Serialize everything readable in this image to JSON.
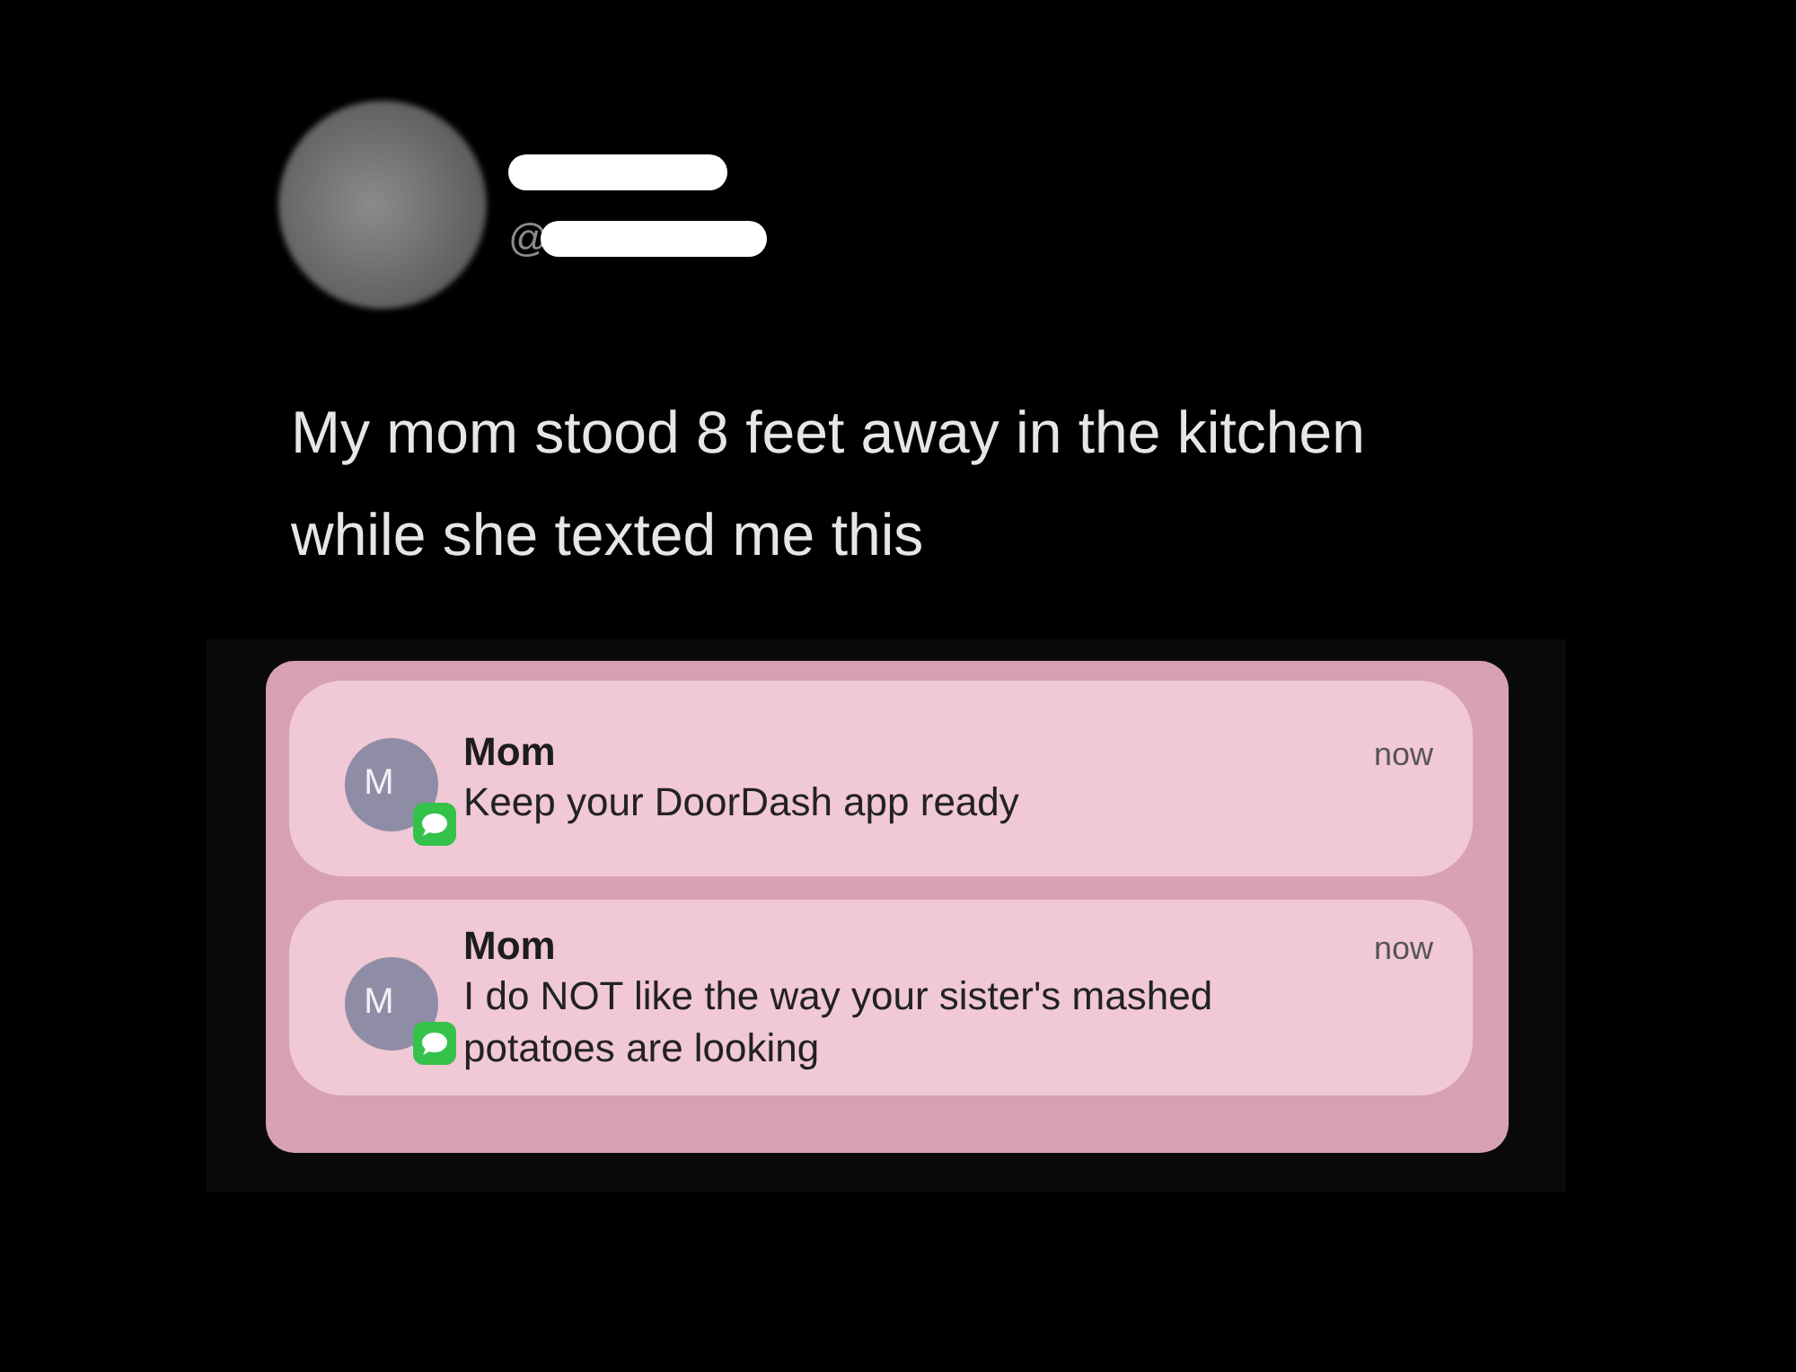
{
  "tweet": {
    "handle_prefix": "@",
    "text": "My mom stood 8 feet away in the kitchen while she texted me this"
  },
  "screenshot": {
    "notifications": [
      {
        "avatar_letter": "M",
        "sender": "Mom",
        "message": "Keep your DoorDash app ready",
        "time": "now"
      },
      {
        "avatar_letter": "M",
        "sender": "Mom",
        "message": "I do NOT like the way your sister's mashed potatoes are looking",
        "time": "now"
      }
    ]
  }
}
